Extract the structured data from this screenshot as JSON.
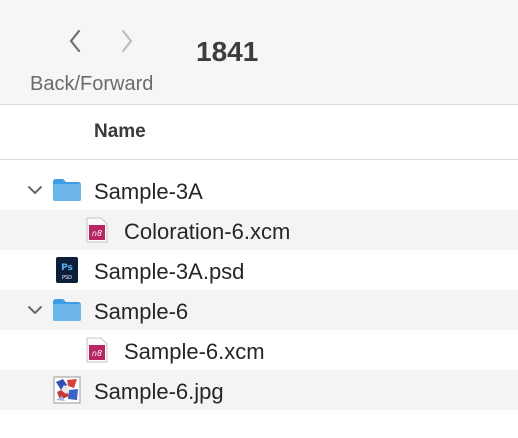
{
  "toolbar": {
    "nav_label": "Back/Forward",
    "title": "1841"
  },
  "columns": {
    "name": "Name"
  },
  "files": [
    {
      "label": "Sample-3A",
      "kind": "folder",
      "expanded": true
    },
    {
      "label": "Coloration-6.xcm",
      "kind": "xcm"
    },
    {
      "label": "Sample-3A.psd",
      "kind": "psd"
    },
    {
      "label": "Sample-6",
      "kind": "folder",
      "expanded": true
    },
    {
      "label": "Sample-6.xcm",
      "kind": "xcm"
    },
    {
      "label": "Sample-6.jpg",
      "kind": "jpg"
    }
  ],
  "icons": {
    "folder_color": "#6cb6ec",
    "xcm_color": "#b8255f",
    "xcm_glyph": "n8",
    "psd_bg": "#0b1e3a",
    "psd_text_color": "#58b4f5",
    "psd_glyph": "Ps",
    "psd_sub": "PSD"
  }
}
